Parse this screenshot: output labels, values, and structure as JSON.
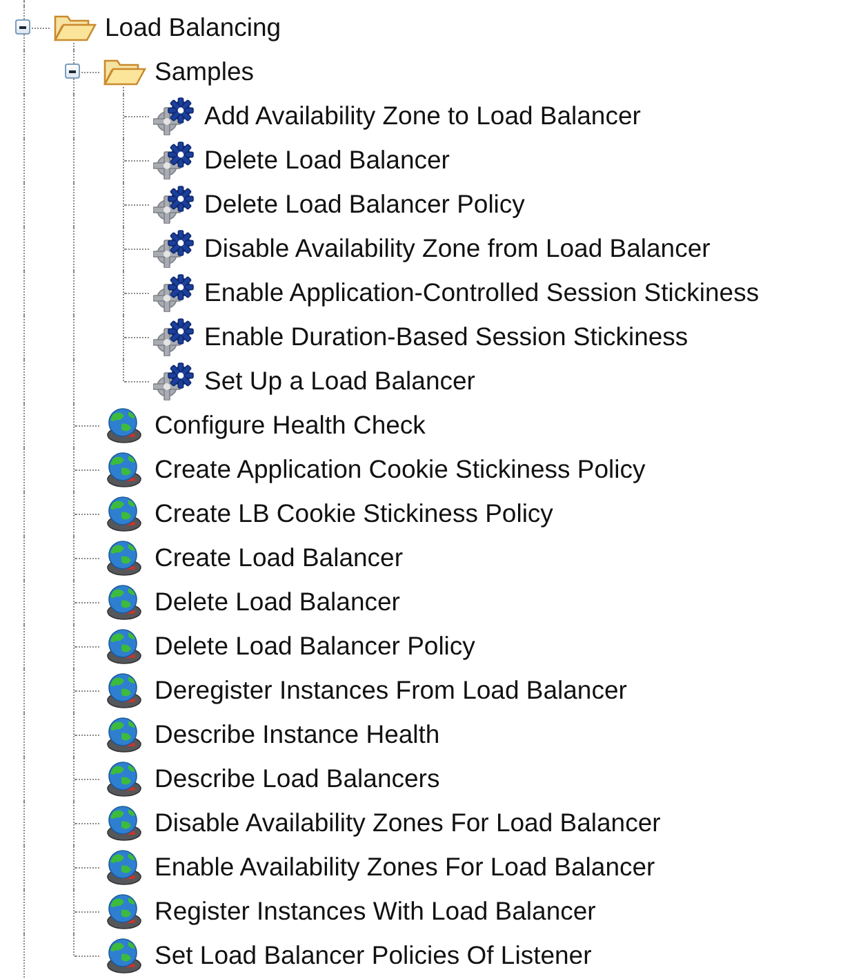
{
  "tree": [
    {
      "label": "Load Balancing",
      "kind": "folder",
      "expanded": true,
      "children": [
        {
          "label": "Samples",
          "kind": "folder",
          "expanded": true,
          "children": [
            {
              "label": "Add Availability Zone to Load Balancer",
              "kind": "sample"
            },
            {
              "label": "Delete Load Balancer",
              "kind": "sample"
            },
            {
              "label": "Delete Load Balancer Policy",
              "kind": "sample"
            },
            {
              "label": "Disable Availability Zone from Load Balancer",
              "kind": "sample"
            },
            {
              "label": "Enable Application-Controlled Session Stickiness",
              "kind": "sample"
            },
            {
              "label": "Enable Duration-Based Session Stickiness",
              "kind": "sample"
            },
            {
              "label": "Set Up a Load Balancer",
              "kind": "sample"
            }
          ]
        },
        {
          "label": "Configure Health Check",
          "kind": "operation"
        },
        {
          "label": "Create Application Cookie Stickiness Policy",
          "kind": "operation"
        },
        {
          "label": "Create LB Cookie Stickiness Policy",
          "kind": "operation"
        },
        {
          "label": "Create Load Balancer",
          "kind": "operation"
        },
        {
          "label": "Delete Load Balancer",
          "kind": "operation"
        },
        {
          "label": "Delete Load Balancer Policy",
          "kind": "operation"
        },
        {
          "label": "Deregister Instances From Load Balancer",
          "kind": "operation"
        },
        {
          "label": "Describe Instance Health",
          "kind": "operation"
        },
        {
          "label": "Describe Load Balancers",
          "kind": "operation"
        },
        {
          "label": "Disable Availability Zones For Load Balancer",
          "kind": "operation"
        },
        {
          "label": "Enable Availability Zones For Load Balancer",
          "kind": "operation"
        },
        {
          "label": "Register Instances With Load Balancer",
          "kind": "operation"
        },
        {
          "label": "Set Load Balancer Policies Of Listener",
          "kind": "operation"
        }
      ]
    }
  ]
}
